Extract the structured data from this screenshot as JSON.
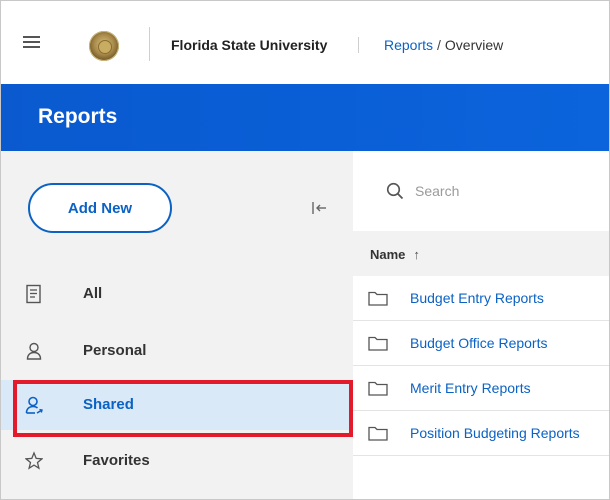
{
  "topbar": {
    "org_name": "Florida State University",
    "breadcrumb": {
      "link": "Reports",
      "separator": "/",
      "current": "Overview"
    }
  },
  "header": {
    "title": "Reports"
  },
  "sidebar": {
    "add_new_label": "Add New",
    "items": [
      {
        "label": "All",
        "icon": "document-list-icon"
      },
      {
        "label": "Personal",
        "icon": "person-icon"
      },
      {
        "label": "Shared",
        "icon": "shared-person-icon",
        "selected": true
      },
      {
        "label": "Favorites",
        "icon": "star-icon"
      }
    ]
  },
  "main": {
    "search": {
      "placeholder": "Search"
    },
    "table": {
      "column_name": "Name",
      "sort_indicator": "↑",
      "rows": [
        {
          "name": "Budget Entry Reports"
        },
        {
          "name": "Budget Office Reports"
        },
        {
          "name": "Merit Entry Reports"
        },
        {
          "name": "Position Budgeting Reports"
        }
      ]
    }
  },
  "colors": {
    "brand_blue": "#0b5ed7",
    "link_blue": "#0b62c4",
    "selected_bg": "#d9e9f8",
    "highlight_red": "#e31a2c"
  }
}
